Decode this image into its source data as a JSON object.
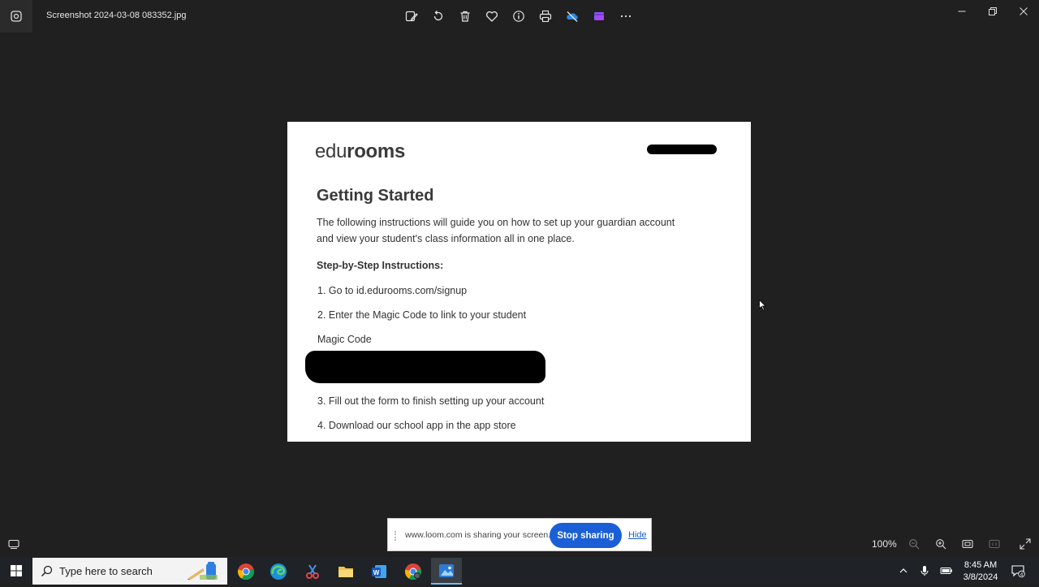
{
  "window": {
    "title": "Screenshot 2024-03-08 083352.jpg"
  },
  "toolbar": {
    "icons": [
      "edit-image-icon",
      "rotate-icon",
      "delete-icon",
      "favorite-icon",
      "info-icon",
      "print-icon",
      "onedrive-icon",
      "clipchamp-icon",
      "more-icon"
    ]
  },
  "document": {
    "logo_light": "edu",
    "logo_bold": "rooms",
    "heading": "Getting Started",
    "intro_line1": "The following instructions will guide you on how to set up your guardian account",
    "intro_line2": "and view your student's class information all in one place.",
    "steps_heading": "Step-by-Step Instructions:",
    "step1": "1. Go to id.edurooms.com/signup",
    "step2": "2. Enter the Magic Code to link to your student",
    "magic_code_label": "Magic Code",
    "step3": "3. Fill out the form to finish setting up your account",
    "step4": "4. Download our school app in the app store"
  },
  "statusbar": {
    "zoom": "100%"
  },
  "loom": {
    "message": "www.loom.com is sharing your screen.",
    "stop_label": "Stop sharing",
    "hide_label": "Hide"
  },
  "taskbar": {
    "search_placeholder": "Type here to search",
    "clock_time": "8:45 AM",
    "clock_date": "3/8/2024",
    "notification_count": "4"
  },
  "colors": {
    "background": "#202020",
    "accent": "#1a5fd6",
    "taskbar": "#1f2226"
  }
}
